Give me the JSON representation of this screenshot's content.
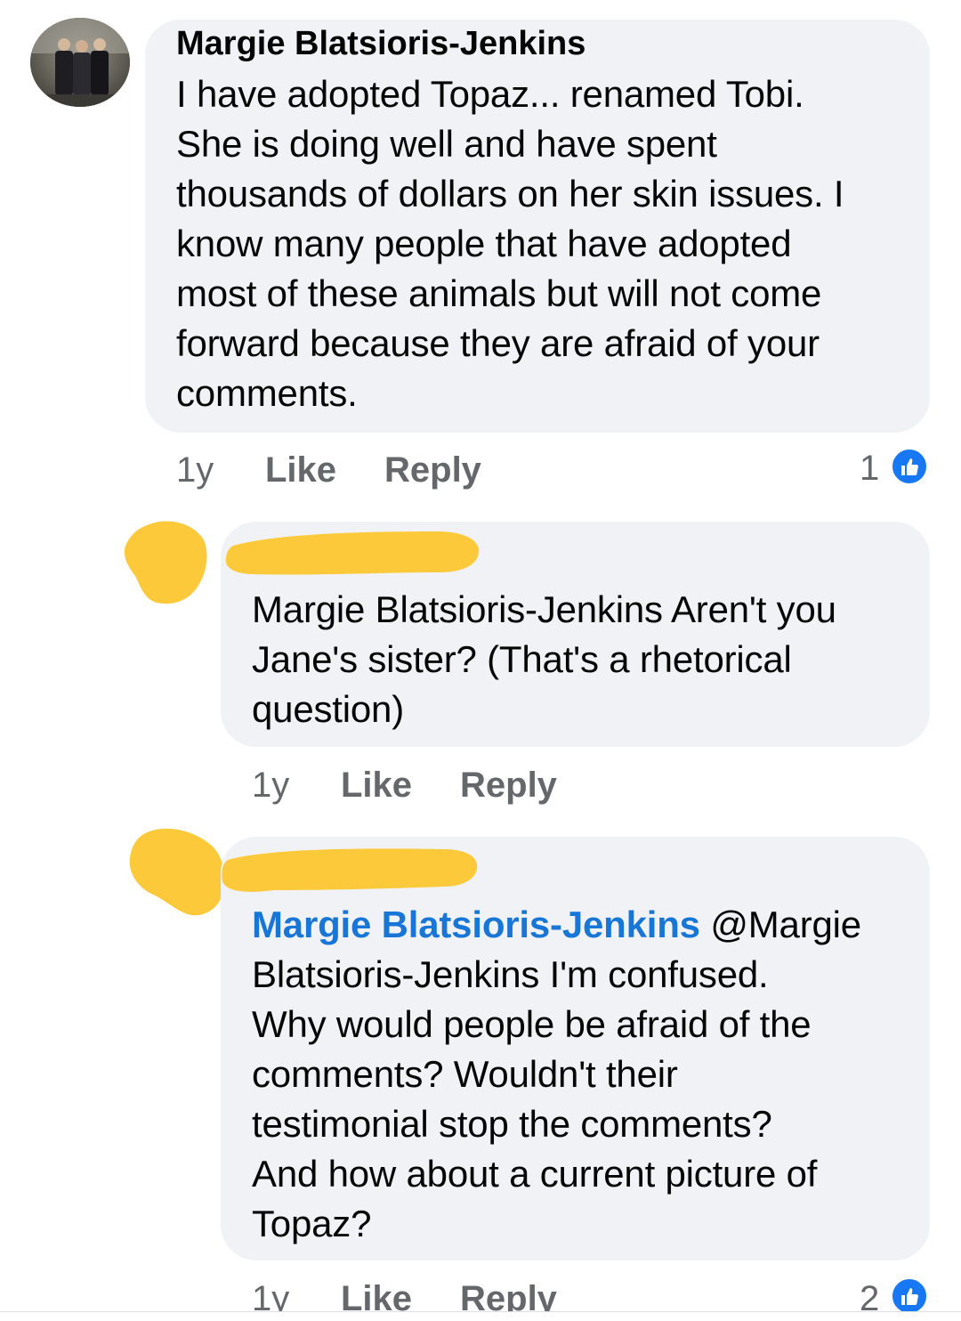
{
  "comments": [
    {
      "author": "Margie Blatsioris-Jenkins",
      "text": "I have adopted Topaz... renamed Tobi.\nShe is doing well and have spent\nthousands of dollars on her skin issues. I\nknow many people that have adopted\nmost of these animals but will not come\nforward because they are afraid of your\ncomments.",
      "age": "1y",
      "like_label": "Like",
      "reply_label": "Reply",
      "reaction_count": "1",
      "reaction_icon": "thumbs-up-icon"
    },
    {
      "author": "",
      "text": "Margie Blatsioris-Jenkins Aren't you\nJane's sister? (That's a rhetorical\nquestion)",
      "age": "1y",
      "like_label": "Like",
      "reply_label": "Reply"
    },
    {
      "author": "",
      "mention": "Margie Blatsioris-Jenkins",
      "text": " @Margie\nBlatsioris-Jenkins I'm confused.\nWhy would people be afraid of the\ncomments? Wouldn't their\ntestimonial stop the comments?\nAnd how about a current picture of\nTopaz?",
      "age": "1y",
      "like_label": "Like",
      "reply_label": "Reply",
      "reaction_count": "2",
      "reaction_icon": "thumbs-up-icon"
    }
  ],
  "colors": {
    "bubble": "#f0f2f5",
    "mention": "#1876d6",
    "meta_text": "#65676b",
    "like_badge": "#1877f2",
    "redaction": "#fcc93a"
  }
}
